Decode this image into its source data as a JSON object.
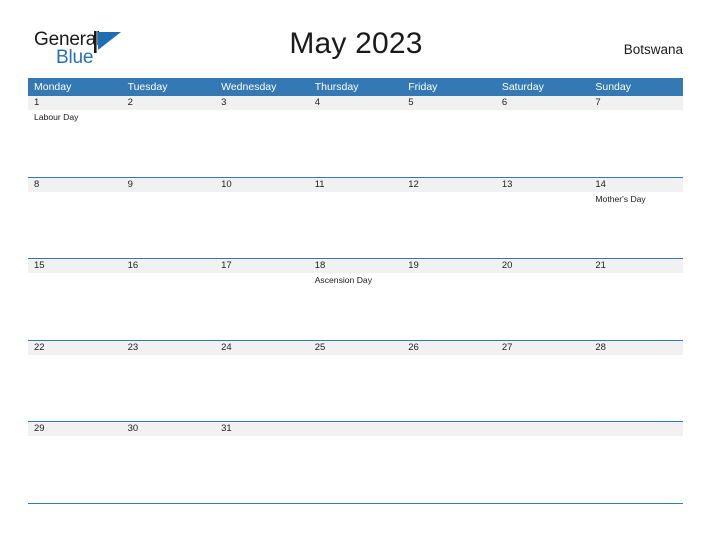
{
  "brand": {
    "name_part1": "General",
    "name_part2": "Blue",
    "flag_icon": "flag-triangle-icon",
    "accent_color": "#2770b3"
  },
  "header": {
    "title": "May 2023",
    "region": "Botswana"
  },
  "colors": {
    "header_blue": "#3479b4",
    "row_band_gray": "#f1f1f1",
    "rule_blue": "#3479b4",
    "text": "#1a1a1a"
  },
  "calendar": {
    "month": "May",
    "year": "2023",
    "weekday_headers": [
      "Monday",
      "Tuesday",
      "Wednesday",
      "Thursday",
      "Friday",
      "Saturday",
      "Sunday"
    ],
    "weeks": [
      {
        "days": [
          {
            "number": "1",
            "events": [
              "Labour Day"
            ]
          },
          {
            "number": "2",
            "events": []
          },
          {
            "number": "3",
            "events": []
          },
          {
            "number": "4",
            "events": []
          },
          {
            "number": "5",
            "events": []
          },
          {
            "number": "6",
            "events": []
          },
          {
            "number": "7",
            "events": []
          }
        ]
      },
      {
        "days": [
          {
            "number": "8",
            "events": []
          },
          {
            "number": "9",
            "events": []
          },
          {
            "number": "10",
            "events": []
          },
          {
            "number": "11",
            "events": []
          },
          {
            "number": "12",
            "events": []
          },
          {
            "number": "13",
            "events": []
          },
          {
            "number": "14",
            "events": [
              "Mother's Day"
            ]
          }
        ]
      },
      {
        "days": [
          {
            "number": "15",
            "events": []
          },
          {
            "number": "16",
            "events": []
          },
          {
            "number": "17",
            "events": []
          },
          {
            "number": "18",
            "events": [
              "Ascension Day"
            ]
          },
          {
            "number": "19",
            "events": []
          },
          {
            "number": "20",
            "events": []
          },
          {
            "number": "21",
            "events": []
          }
        ]
      },
      {
        "days": [
          {
            "number": "22",
            "events": []
          },
          {
            "number": "23",
            "events": []
          },
          {
            "number": "24",
            "events": []
          },
          {
            "number": "25",
            "events": []
          },
          {
            "number": "26",
            "events": []
          },
          {
            "number": "27",
            "events": []
          },
          {
            "number": "28",
            "events": []
          }
        ]
      },
      {
        "days": [
          {
            "number": "29",
            "events": []
          },
          {
            "number": "30",
            "events": []
          },
          {
            "number": "31",
            "events": []
          },
          {
            "number": "",
            "events": []
          },
          {
            "number": "",
            "events": []
          },
          {
            "number": "",
            "events": []
          },
          {
            "number": "",
            "events": []
          }
        ]
      }
    ]
  }
}
